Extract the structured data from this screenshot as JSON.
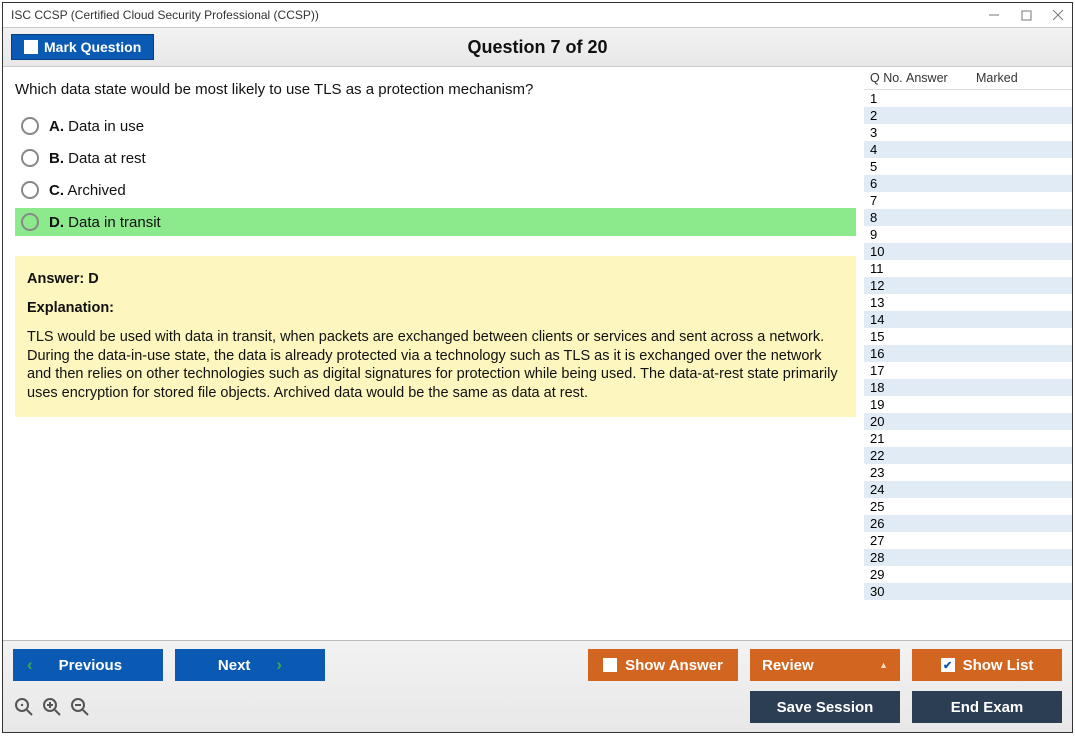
{
  "window": {
    "title": "ISC CCSP (Certified Cloud Security Professional (CCSP))"
  },
  "header": {
    "mark_label": "Mark Question",
    "counter": "Question 7 of 20"
  },
  "question": {
    "text": "Which data state would be most likely to use TLS as a protection mechanism?",
    "options": [
      {
        "letter": "A.",
        "text": "Data in use",
        "correct": false
      },
      {
        "letter": "B.",
        "text": "Data at rest",
        "correct": false
      },
      {
        "letter": "C.",
        "text": "Archived",
        "correct": false
      },
      {
        "letter": "D.",
        "text": "Data in transit",
        "correct": true
      }
    ],
    "answer_line": "Answer: D",
    "explanation_label": "Explanation:",
    "explanation_text": "TLS would be used with data in transit, when packets are exchanged between clients or services and sent across a network. During the data-in-use state, the data is already protected via a technology such as TLS as it is exchanged over the network and then relies on other technologies such as digital signatures for protection while being used. The data-at-rest state primarily uses encryption for stored file objects. Archived data would be the same as data at rest."
  },
  "sidebar": {
    "col_q": "Q No.",
    "col_a": "Answer",
    "col_m": "Marked",
    "rows": [
      {
        "n": "1"
      },
      {
        "n": "2"
      },
      {
        "n": "3"
      },
      {
        "n": "4"
      },
      {
        "n": "5"
      },
      {
        "n": "6"
      },
      {
        "n": "7"
      },
      {
        "n": "8"
      },
      {
        "n": "9"
      },
      {
        "n": "10"
      },
      {
        "n": "11"
      },
      {
        "n": "12"
      },
      {
        "n": "13"
      },
      {
        "n": "14"
      },
      {
        "n": "15"
      },
      {
        "n": "16"
      },
      {
        "n": "17"
      },
      {
        "n": "18"
      },
      {
        "n": "19"
      },
      {
        "n": "20"
      },
      {
        "n": "21"
      },
      {
        "n": "22"
      },
      {
        "n": "23"
      },
      {
        "n": "24"
      },
      {
        "n": "25"
      },
      {
        "n": "26"
      },
      {
        "n": "27"
      },
      {
        "n": "28"
      },
      {
        "n": "29"
      },
      {
        "n": "30"
      }
    ]
  },
  "footer": {
    "previous": "Previous",
    "next": "Next",
    "show_answer": "Show Answer",
    "review": "Review",
    "show_list": "Show List",
    "save_session": "Save Session",
    "end_exam": "End Exam"
  }
}
